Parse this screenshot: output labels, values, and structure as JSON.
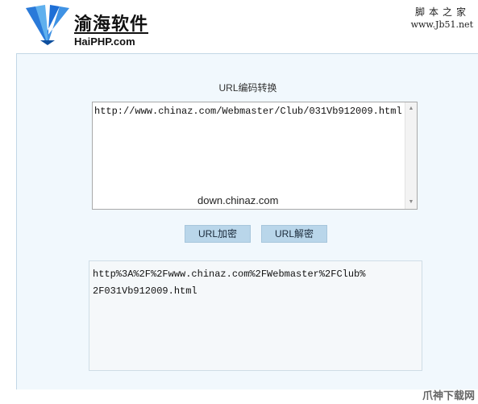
{
  "header": {
    "logo_cn": "渝海软件",
    "logo_en": "HaiPHP.com",
    "site_title": "脚本之家",
    "site_url": "www.Jb51.net"
  },
  "tool": {
    "title": "URL编码转换",
    "input_value": "http://www.chinaz.com/Webmaster/Club/031Vb912009.html",
    "input_watermark": "down.chinaz.com",
    "encode_label": "URL加密",
    "decode_label": "URL解密",
    "output_lines": [
      "http%3A%2F%2Fwww.chinaz.com%2FWebmaster%2FClub%",
      "2F031Vb912009.html"
    ]
  },
  "footer": {
    "watermark": "爪神下载网"
  },
  "icons": {
    "logo": "fan-logo-icon",
    "scroll_up": "scroll-up-arrow-icon",
    "scroll_down": "scroll-down-arrow-icon"
  },
  "colors": {
    "panel_bg": "#f1f8fd",
    "button_bg": "#b9d6ea",
    "logo_blue": "#1e6fd6",
    "logo_light_blue": "#5fb0ee"
  }
}
